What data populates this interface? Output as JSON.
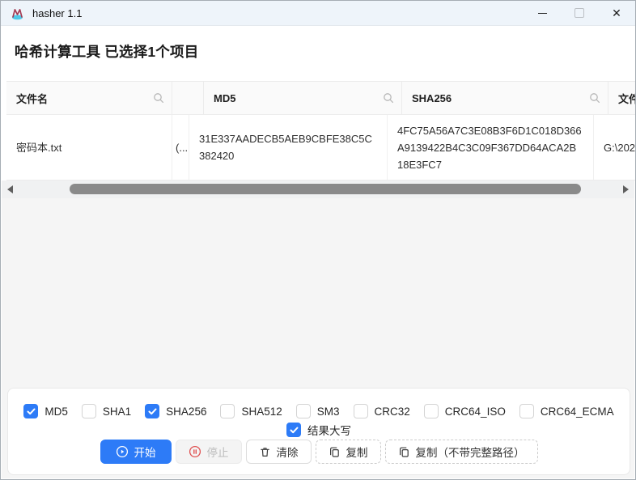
{
  "titlebar": {
    "app_title": "hasher 1.1"
  },
  "header": {
    "title": "哈希计算工具 已选择1个项目"
  },
  "table": {
    "columns": [
      {
        "label": "文件名"
      },
      {
        "label": ""
      },
      {
        "label": "MD5"
      },
      {
        "label": "SHA256"
      },
      {
        "label": "文件完"
      }
    ],
    "rows": [
      {
        "filename": "密码本.txt",
        "truncated_cell": "(...",
        "md5": "31E337AADECB5AEB9CBFE38C5C382420",
        "sha256": "4FC75A56A7C3E08B3F6D1C018D366A9139422B4C3C09F367DD64ACA2B18E3FC7",
        "path": "G:\\202"
      }
    ]
  },
  "options": {
    "algorithms": [
      {
        "label": "MD5",
        "checked": true
      },
      {
        "label": "SHA1",
        "checked": false
      },
      {
        "label": "SHA256",
        "checked": true
      },
      {
        "label": "SHA512",
        "checked": false
      },
      {
        "label": "SM3",
        "checked": false
      },
      {
        "label": "CRC32",
        "checked": false
      },
      {
        "label": "CRC64_ISO",
        "checked": false
      },
      {
        "label": "CRC64_ECMA",
        "checked": false
      }
    ],
    "uppercase": {
      "label": "结果大写",
      "checked": true
    }
  },
  "actions": {
    "start": "开始",
    "stop": "停止",
    "clear": "清除",
    "copy": "复制",
    "copy_no_path": "复制（不带完整路径）"
  },
  "icons": {
    "app": "hasher-logo",
    "search": "magnifier",
    "start": "play-circle",
    "stop": "pause-circle",
    "clear": "trash",
    "copy": "duplicate-squares",
    "checked": "checkmark",
    "minimize": "−",
    "maximize": "□",
    "close": "✕",
    "scroll_left": "◀",
    "scroll_right": "▶"
  },
  "colors": {
    "accent": "#2d7bf7",
    "stop_icon_red": "#e05252",
    "titlebar_bg": "#eef4fa",
    "scroll_thumb": "#8a8a8a"
  }
}
